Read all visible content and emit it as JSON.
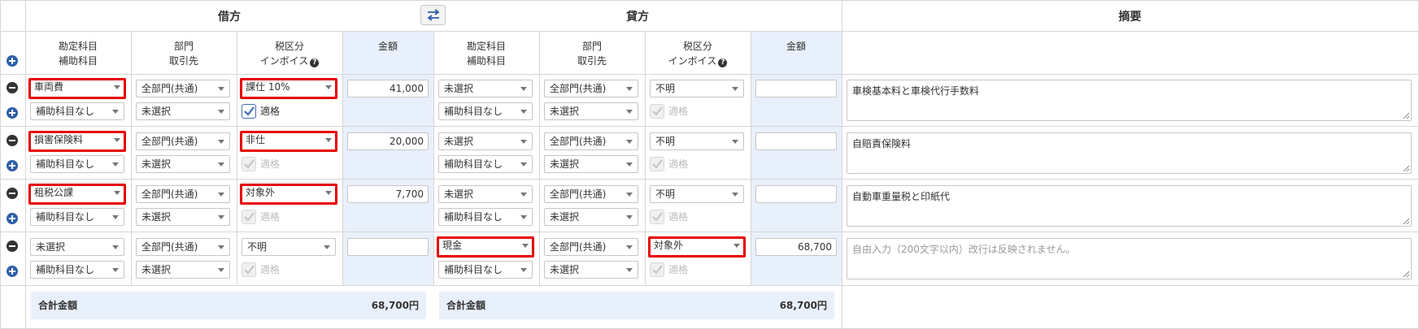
{
  "headers": {
    "debit": "借方",
    "credit": "貸方",
    "memo": "摘要"
  },
  "columns": {
    "account": [
      "勘定科目",
      "補助科目"
    ],
    "dept": [
      "部門",
      "取引先"
    ],
    "tax": [
      "税区分",
      "インボイス"
    ],
    "amount": "金額"
  },
  "help_icon_glyph": "?",
  "rows": [
    {
      "debit": {
        "account": "車両費",
        "sub": "補助科目なし",
        "dept": "全部門(共通)",
        "partner": "未選択",
        "tax": "課仕 10%",
        "invoice_checked": true,
        "invoice_label": "適格",
        "amount": "41,000"
      },
      "credit": {
        "account": "未選択",
        "sub": "補助科目なし",
        "dept": "全部門(共通)",
        "partner": "未選択",
        "tax": "不明",
        "invoice_checked": true,
        "invoice_label": "適格",
        "amount": ""
      },
      "memo": "車検基本料と車検代行手数料"
    },
    {
      "debit": {
        "account": "損害保険料",
        "sub": "補助科目なし",
        "dept": "全部門(共通)",
        "partner": "未選択",
        "tax": "非仕",
        "invoice_checked": true,
        "invoice_label": "適格",
        "amount": "20,000"
      },
      "credit": {
        "account": "未選択",
        "sub": "補助科目なし",
        "dept": "全部門(共通)",
        "partner": "未選択",
        "tax": "不明",
        "invoice_checked": true,
        "invoice_label": "適格",
        "amount": ""
      },
      "memo": "自賠責保険料"
    },
    {
      "debit": {
        "account": "租税公課",
        "sub": "補助科目なし",
        "dept": "全部門(共通)",
        "partner": "未選択",
        "tax": "対象外",
        "invoice_checked": true,
        "invoice_label": "適格",
        "amount": "7,700"
      },
      "credit": {
        "account": "未選択",
        "sub": "補助科目なし",
        "dept": "全部門(共通)",
        "partner": "未選択",
        "tax": "不明",
        "invoice_checked": true,
        "invoice_label": "適格",
        "amount": ""
      },
      "memo": "自動車重量税と印紙代"
    },
    {
      "debit": {
        "account": "未選択",
        "sub": "補助科目なし",
        "dept": "全部門(共通)",
        "partner": "未選択",
        "tax": "不明",
        "invoice_checked": true,
        "invoice_label": "適格",
        "amount": ""
      },
      "credit": {
        "account": "現金",
        "sub": "補助科目なし",
        "dept": "全部門(共通)",
        "partner": "未選択",
        "tax": "対象外",
        "invoice_checked": true,
        "invoice_label": "適格",
        "amount": "68,700"
      },
      "memo_placeholder": "自由入力（200文字以内）改行は反映されません。"
    }
  ],
  "totals": {
    "label": "合計金額",
    "debit": "68,700円",
    "credit": "68,700円"
  },
  "colors": {
    "highlight": "#e60000",
    "accent": "#2f5fa7",
    "amount_bg": "#e8f0fb"
  }
}
